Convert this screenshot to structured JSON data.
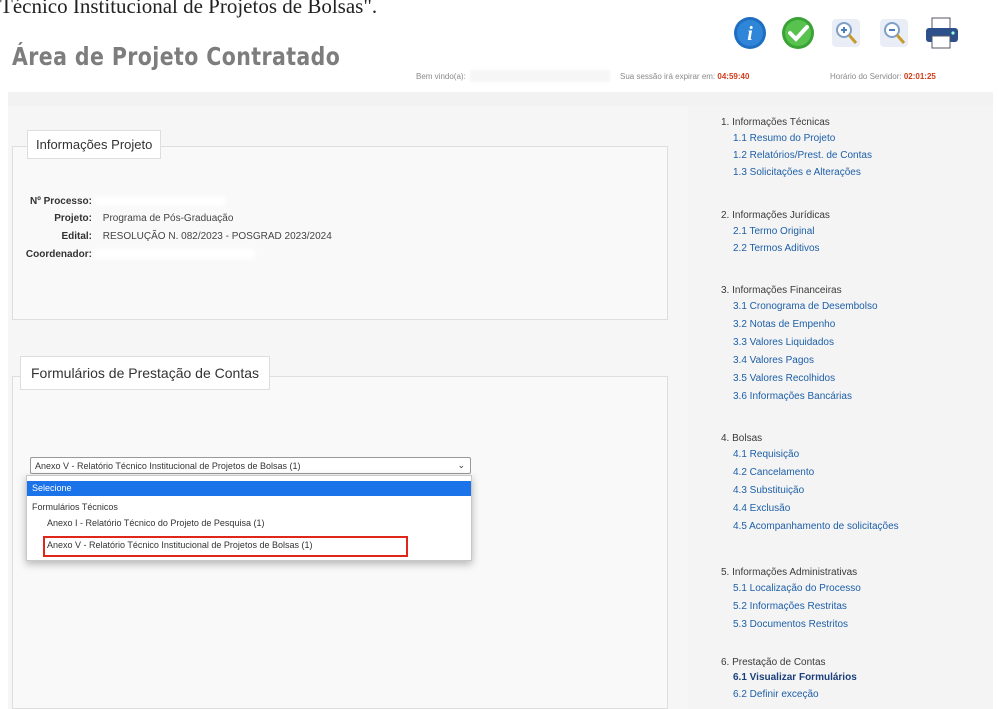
{
  "caption": "Técnico Institucional de Projetos de Bolsas\".",
  "app_title": "Área de Projeto Contratado",
  "toolbar": {
    "icons": [
      "info-icon",
      "check-icon",
      "zoom-in-icon",
      "zoom-out-icon",
      "print-icon"
    ]
  },
  "header": {
    "user_label": "Bem vindo(a):",
    "session_label": "Sua sessão irá expirar em:",
    "session_value": "04:59:40",
    "clock_label": "Horário do Servidor:",
    "clock_value": "02:01:25"
  },
  "project_info": {
    "legend": "Informações Projeto",
    "rows": [
      {
        "label": "Nº Processo:",
        "value": ""
      },
      {
        "label": "Projeto:",
        "value": "Programa de Pós-Graduação"
      },
      {
        "label": "Edital:",
        "value": "RESOLUÇÃO N. 082/2023 - POSGRAD 2023/2024"
      },
      {
        "label": "Coordenador:",
        "value": ""
      }
    ]
  },
  "forms": {
    "legend": "Formulários de Prestação de Contas",
    "select_value": "Anexo V - Relatório Técnico Institucional de Projetos de Bolsas (1)",
    "options": {
      "selected": "Selecione",
      "group": "Formulários Técnicos",
      "item1": "Anexo I - Relatório Técnico do Projeto de Pesquisa (1)",
      "item2": "Anexo V - Relatório Técnico Institucional de Projetos de Bolsas (1)"
    }
  },
  "menu": [
    {
      "header": "1. Informações Técnicas",
      "items": [
        "1.1 Resumo do Projeto",
        "1.2 Relatórios/Prest. de Contas",
        "1.3 Solicitações e Alterações"
      ]
    },
    {
      "header": "2. Informações Jurídicas",
      "items": [
        "2.1 Termo Original",
        "2.2 Termos Aditivos"
      ]
    },
    {
      "header": "3. Informações Financeiras",
      "items": [
        "3.1 Cronograma de Desembolso",
        "3.2 Notas de Empenho",
        "3.3 Valores Liquidados",
        "3.4 Valores Pagos",
        "3.5 Valores Recolhidos",
        "3.6 Informações Bancárias"
      ]
    },
    {
      "header": "4. Bolsas",
      "items": [
        "4.1 Requisição",
        "4.2 Cancelamento",
        "4.3 Substituição",
        "4.4 Exclusão",
        "4.5 Acompanhamento de solicitações"
      ]
    },
    {
      "header": "5. Informações Administrativas",
      "items": [
        "5.1 Localização do Processo",
        "5.2 Informações Restritas",
        "5.3 Documentos Restritos"
      ]
    },
    {
      "header": "6. Prestação de Contas",
      "items": [
        "6.1 Visualizar Formulários",
        "6.2 Definir exceção"
      ]
    }
  ]
}
